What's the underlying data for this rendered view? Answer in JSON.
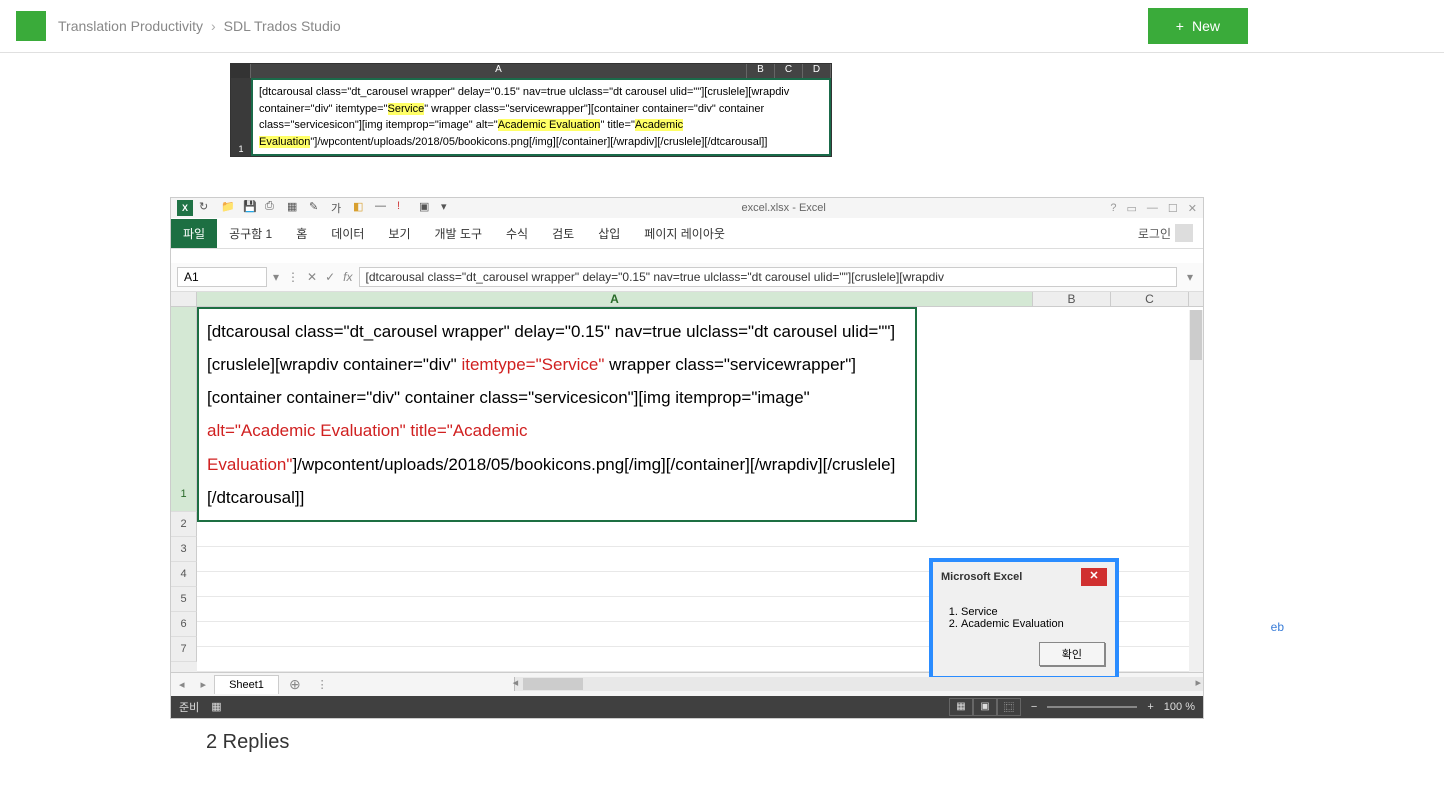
{
  "topbar": {
    "breadcrumb": [
      "Translation Productivity",
      "SDL Trados Studio"
    ],
    "new_button": "New"
  },
  "image1": {
    "columns": [
      "A",
      "B",
      "C",
      "D"
    ],
    "row_number": "1",
    "cell_parts": {
      "p1": "[dtcarousal class=\"dt_carousel wrapper\" delay=\"0.15\" nav=true ulclass=\"dt carousel ulid=\"\"][cruslele][wrapdiv container=\"div\" itemtype=\"",
      "h1": "Service",
      "p2": "\" wrapper class=\"servicewrapper\"][container container=\"div\" container class=\"servicesicon\"][img itemprop=\"image\" alt=\"",
      "h2": "Academic Evaluation",
      "p3": "\" title=\"",
      "h3": "Academic Evaluation",
      "p4": "\"]/wpcontent/uploads/2018/05/bookicons.png[/img][/container][/wrapdiv][/cruslele][/dtcarousal]]"
    }
  },
  "excel": {
    "title": "excel.xlsx - Excel",
    "ribbon_tabs": {
      "file": "파일",
      "t1": "공구함 1",
      "t2": "홈",
      "t3": "데이터",
      "t4": "보기",
      "t5": "개발 도구",
      "t6": "수식",
      "t7": "검토",
      "t8": "삽입",
      "t9": "페이지 레이아웃"
    },
    "login": "로그인",
    "namebox": "A1",
    "formula": "[dtcarousal class=\"dt_carousel wrapper\" delay=\"0.15\" nav=true ulclass=\"dt carousel ulid=\"\"][cruslele][wrapdiv",
    "columns": [
      "A",
      "B",
      "C"
    ],
    "row_numbers": [
      "1",
      "2",
      "3",
      "4",
      "5",
      "6",
      "7"
    ],
    "bigcell": {
      "p1": "[dtcarousal class=\"dt_carousel wrapper\" delay=\"0.15\" nav=true ulclass=\"dt carousel ulid=\"\"][cruslele][wrapdiv container=\"div\" ",
      "r1": "itemtype=\"Service\"",
      "p2": " wrapper class=\"servicewrapper\"][container container=\"div\" container class=\"servicesicon\"][img itemprop=\"image\" ",
      "r2": "alt=\"Academic Evaluation\" title=\"Academic Evaluation\"",
      "p3": "]/wpcontent/uploads/2018/05/bookicons.png[/img][/container][/wrapdiv][/cruslele][/dtcarousal]]"
    },
    "dialog": {
      "title": "Microsoft Excel",
      "items": [
        "Service",
        "Academic Evaluation"
      ],
      "ok": "확인"
    },
    "sheet_tab": "Sheet1",
    "status_ready": "준비",
    "zoom": "100 %"
  },
  "replies_heading": "2 Replies",
  "side_web_label": "eb"
}
